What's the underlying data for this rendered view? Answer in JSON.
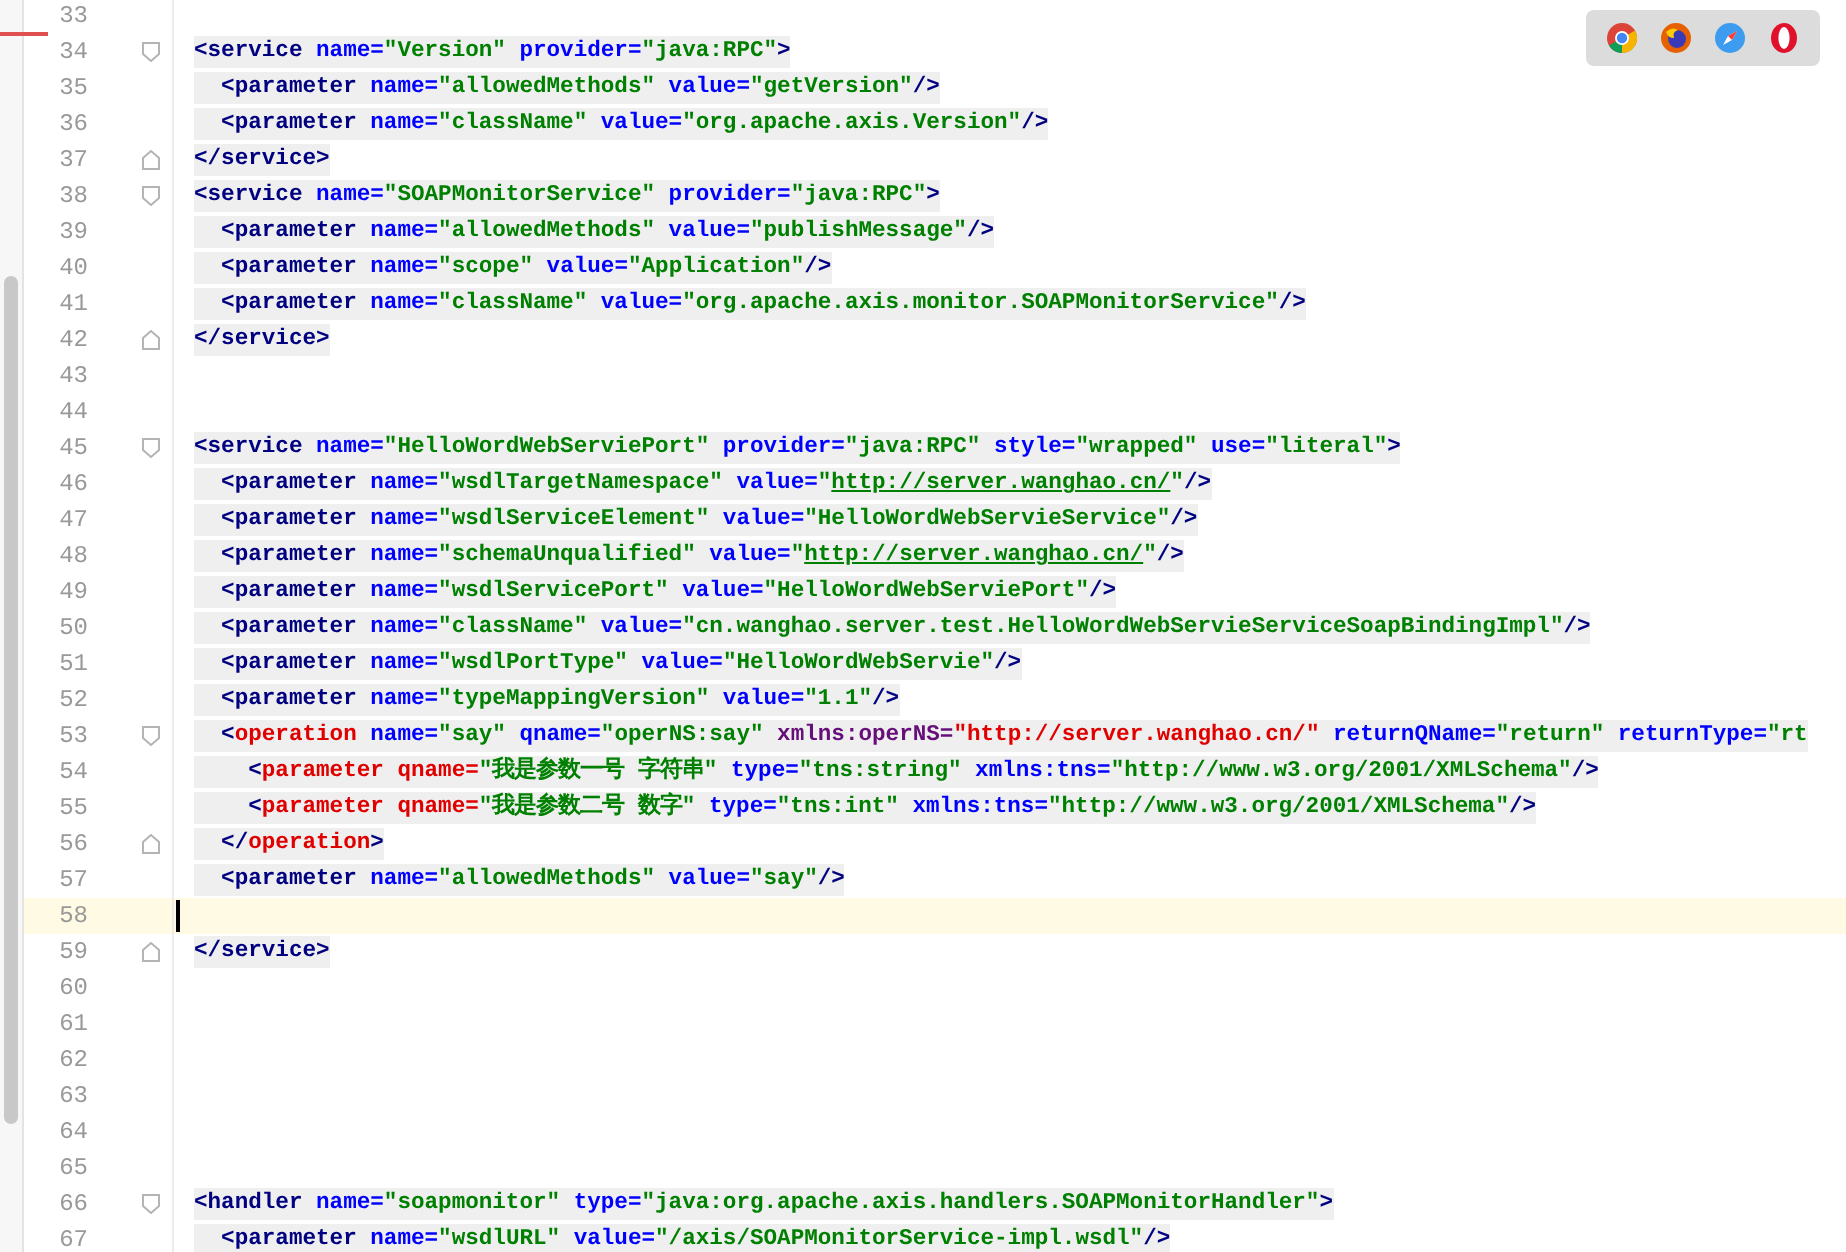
{
  "browsers": [
    {
      "kind": "chrome"
    },
    {
      "kind": "firefox"
    },
    {
      "kind": "safari"
    },
    {
      "kind": "opera"
    }
  ],
  "lines": [
    {
      "number": "33",
      "kind": "plain"
    },
    {
      "number": "34",
      "kind": "fold_start",
      "tokens": [
        {
          "kind": "tag",
          "text": "<service"
        },
        {
          "kind": "attr",
          "text": " name="
        },
        {
          "kind": "val",
          "text": "\"Version\""
        },
        {
          "kind": "attr",
          "text": " provider="
        },
        {
          "kind": "val",
          "text": "\"java:RPC\""
        },
        {
          "kind": "tag",
          "text": ">"
        }
      ]
    },
    {
      "number": "35",
      "kind": "plain",
      "tokens": [
        {
          "kind": "tag",
          "text": "  <parameter"
        },
        {
          "kind": "attr",
          "text": " name="
        },
        {
          "kind": "val",
          "text": "\"allowedMethods\""
        },
        {
          "kind": "attr",
          "text": " value="
        },
        {
          "kind": "val",
          "text": "\"getVersion\""
        },
        {
          "kind": "tag",
          "text": "/>"
        }
      ]
    },
    {
      "number": "36",
      "kind": "plain",
      "tokens": [
        {
          "kind": "tag",
          "text": "  <parameter"
        },
        {
          "kind": "attr",
          "text": " name="
        },
        {
          "kind": "val",
          "text": "\"className\""
        },
        {
          "kind": "attr",
          "text": " value="
        },
        {
          "kind": "val",
          "text": "\"org.apache.axis.Version\""
        },
        {
          "kind": "tag",
          "text": "/>"
        }
      ]
    },
    {
      "number": "37",
      "kind": "fold_end",
      "tokens": [
        {
          "kind": "tag",
          "text": "</service>"
        }
      ]
    },
    {
      "number": "38",
      "kind": "fold_start",
      "tokens": [
        {
          "kind": "tag",
          "text": "<service"
        },
        {
          "kind": "attr",
          "text": " name="
        },
        {
          "kind": "val",
          "text": "\"SOAPMonitorService\""
        },
        {
          "kind": "attr",
          "text": " provider="
        },
        {
          "kind": "val",
          "text": "\"java:RPC\""
        },
        {
          "kind": "tag",
          "text": ">"
        }
      ]
    },
    {
      "number": "39",
      "kind": "plain",
      "tokens": [
        {
          "kind": "tag",
          "text": "  <parameter"
        },
        {
          "kind": "attr",
          "text": " name="
        },
        {
          "kind": "val",
          "text": "\"allowedMethods\""
        },
        {
          "kind": "attr",
          "text": " value="
        },
        {
          "kind": "val",
          "text": "\"publishMessage\""
        },
        {
          "kind": "tag",
          "text": "/>"
        }
      ]
    },
    {
      "number": "40",
      "kind": "plain",
      "tokens": [
        {
          "kind": "tag",
          "text": "  <parameter"
        },
        {
          "kind": "attr",
          "text": " name="
        },
        {
          "kind": "val",
          "text": "\"scope\""
        },
        {
          "kind": "attr",
          "text": " value="
        },
        {
          "kind": "val",
          "text": "\"Application\""
        },
        {
          "kind": "tag",
          "text": "/>"
        }
      ]
    },
    {
      "number": "41",
      "kind": "plain",
      "tokens": [
        {
          "kind": "tag",
          "text": "  <parameter"
        },
        {
          "kind": "attr",
          "text": " name="
        },
        {
          "kind": "val",
          "text": "\"className\""
        },
        {
          "kind": "attr",
          "text": " value="
        },
        {
          "kind": "val",
          "text": "\"org.apache.axis.monitor.SOAPMonitorService\""
        },
        {
          "kind": "tag",
          "text": "/>"
        }
      ]
    },
    {
      "number": "42",
      "kind": "fold_end",
      "tokens": [
        {
          "kind": "tag",
          "text": "</service>"
        }
      ]
    },
    {
      "number": "43",
      "kind": "plain"
    },
    {
      "number": "44",
      "kind": "plain"
    },
    {
      "number": "45",
      "kind": "fold_start",
      "tokens": [
        {
          "kind": "tag",
          "text": "<service"
        },
        {
          "kind": "attr",
          "text": " name="
        },
        {
          "kind": "val",
          "text": "\"HelloWordWebServiePort\""
        },
        {
          "kind": "attr",
          "text": " provider="
        },
        {
          "kind": "val",
          "text": "\"java:RPC\""
        },
        {
          "kind": "attr",
          "text": " style="
        },
        {
          "kind": "val",
          "text": "\"wrapped\""
        },
        {
          "kind": "attr",
          "text": " use="
        },
        {
          "kind": "val",
          "text": "\"literal\""
        },
        {
          "kind": "tag",
          "text": ">"
        }
      ]
    },
    {
      "number": "46",
      "kind": "plain",
      "tokens": [
        {
          "kind": "tag",
          "text": "  <parameter"
        },
        {
          "kind": "attr",
          "text": " name="
        },
        {
          "kind": "val",
          "text": "\"wsdlTargetNamespace\""
        },
        {
          "kind": "attr",
          "text": " value="
        },
        {
          "kind": "val",
          "text": "\""
        },
        {
          "kind": "link",
          "text": "http://server.wanghao.cn/"
        },
        {
          "kind": "val",
          "text": "\""
        },
        {
          "kind": "tag",
          "text": "/>"
        }
      ]
    },
    {
      "number": "47",
      "kind": "plain",
      "tokens": [
        {
          "kind": "tag",
          "text": "  <parameter"
        },
        {
          "kind": "attr",
          "text": " name="
        },
        {
          "kind": "val",
          "text": "\"wsdlServiceElement\""
        },
        {
          "kind": "attr",
          "text": " value="
        },
        {
          "kind": "val",
          "text": "\"HelloWordWebServieService\""
        },
        {
          "kind": "tag",
          "text": "/>"
        }
      ]
    },
    {
      "number": "48",
      "kind": "plain",
      "tokens": [
        {
          "kind": "tag",
          "text": "  <parameter"
        },
        {
          "kind": "attr",
          "text": " name="
        },
        {
          "kind": "val",
          "text": "\"schemaUnqualified\""
        },
        {
          "kind": "attr",
          "text": " value="
        },
        {
          "kind": "val",
          "text": "\""
        },
        {
          "kind": "link",
          "text": "http://server.wanghao.cn/"
        },
        {
          "kind": "val",
          "text": "\""
        },
        {
          "kind": "tag",
          "text": "/>"
        }
      ]
    },
    {
      "number": "49",
      "kind": "plain",
      "tokens": [
        {
          "kind": "tag",
          "text": "  <parameter"
        },
        {
          "kind": "attr",
          "text": " name="
        },
        {
          "kind": "val",
          "text": "\"wsdlServicePort\""
        },
        {
          "kind": "attr",
          "text": " value="
        },
        {
          "kind": "val",
          "text": "\"HelloWordWebServiePort\""
        },
        {
          "kind": "tag",
          "text": "/>"
        }
      ]
    },
    {
      "number": "50",
      "kind": "plain",
      "tokens": [
        {
          "kind": "tag",
          "text": "  <parameter"
        },
        {
          "kind": "attr",
          "text": " name="
        },
        {
          "kind": "val",
          "text": "\"className\""
        },
        {
          "kind": "attr",
          "text": " value="
        },
        {
          "kind": "val",
          "text": "\"cn.wanghao.server.test.HelloWordWebServieServiceSoapBindingImpl\""
        },
        {
          "kind": "tag",
          "text": "/>"
        }
      ]
    },
    {
      "number": "51",
      "kind": "plain",
      "tokens": [
        {
          "kind": "tag",
          "text": "  <parameter"
        },
        {
          "kind": "attr",
          "text": " name="
        },
        {
          "kind": "val",
          "text": "\"wsdlPortType\""
        },
        {
          "kind": "attr",
          "text": " value="
        },
        {
          "kind": "val",
          "text": "\"HelloWordWebServie\""
        },
        {
          "kind": "tag",
          "text": "/>"
        }
      ]
    },
    {
      "number": "52",
      "kind": "plain",
      "tokens": [
        {
          "kind": "tag",
          "text": "  <parameter"
        },
        {
          "kind": "attr",
          "text": " name="
        },
        {
          "kind": "val",
          "text": "\"typeMappingVersion\""
        },
        {
          "kind": "attr",
          "text": " value="
        },
        {
          "kind": "val",
          "text": "\"1.1\""
        },
        {
          "kind": "tag",
          "text": "/>"
        }
      ]
    },
    {
      "number": "53",
      "kind": "fold_start",
      "tokens": [
        {
          "kind": "tag",
          "text": "  <"
        },
        {
          "kind": "optag",
          "text": "operation"
        },
        {
          "kind": "attr",
          "text": " name="
        },
        {
          "kind": "val",
          "text": "\"say\""
        },
        {
          "kind": "attr",
          "text": " qname="
        },
        {
          "kind": "val",
          "text": "\"operNS:say\""
        },
        {
          "kind": "nsattr",
          "text": " xmlns:operNS="
        },
        {
          "kind": "redval",
          "text": "\"http://server.wanghao.cn/\""
        },
        {
          "kind": "attr",
          "text": " returnQName="
        },
        {
          "kind": "val",
          "text": "\"return\""
        },
        {
          "kind": "attr",
          "text": " returnType="
        },
        {
          "kind": "val",
          "text": "\"rt"
        }
      ]
    },
    {
      "number": "54",
      "kind": "plain",
      "tokens": [
        {
          "kind": "tag",
          "text": "    <"
        },
        {
          "kind": "optag",
          "text": "parameter qname="
        },
        {
          "kind": "val",
          "text": "\"我是参数一号 字符串\""
        },
        {
          "kind": "attr",
          "text": " type="
        },
        {
          "kind": "val",
          "text": "\"tns:string\""
        },
        {
          "kind": "attr",
          "text": " xmlns:tns="
        },
        {
          "kind": "val",
          "text": "\"http://www.w3.org/2001/XMLSchema\""
        },
        {
          "kind": "tag",
          "text": "/>"
        }
      ]
    },
    {
      "number": "55",
      "kind": "plain",
      "tokens": [
        {
          "kind": "tag",
          "text": "    <"
        },
        {
          "kind": "optag",
          "text": "parameter qname="
        },
        {
          "kind": "val",
          "text": "\"我是参数二号 数字\""
        },
        {
          "kind": "attr",
          "text": " type="
        },
        {
          "kind": "val",
          "text": "\"tns:int\""
        },
        {
          "kind": "attr",
          "text": " xmlns:tns="
        },
        {
          "kind": "val",
          "text": "\"http://www.w3.org/2001/XMLSchema\""
        },
        {
          "kind": "tag",
          "text": "/>"
        }
      ]
    },
    {
      "number": "56",
      "kind": "fold_end",
      "tokens": [
        {
          "kind": "tag",
          "text": "  </"
        },
        {
          "kind": "optag",
          "text": "operation"
        },
        {
          "kind": "tag",
          "text": ">"
        }
      ]
    },
    {
      "number": "57",
      "kind": "plain",
      "tokens": [
        {
          "kind": "tag",
          "text": "  <parameter"
        },
        {
          "kind": "attr",
          "text": " name="
        },
        {
          "kind": "val",
          "text": "\"allowedMethods\""
        },
        {
          "kind": "attr",
          "text": " value="
        },
        {
          "kind": "val",
          "text": "\"say\""
        },
        {
          "kind": "tag",
          "text": "/>"
        }
      ]
    },
    {
      "number": "58",
      "kind": "plain",
      "current": true
    },
    {
      "number": "59",
      "kind": "fold_end",
      "tokens": [
        {
          "kind": "tag",
          "text": "</service>"
        }
      ]
    },
    {
      "number": "60",
      "kind": "plain"
    },
    {
      "number": "61",
      "kind": "plain"
    },
    {
      "number": "62",
      "kind": "plain"
    },
    {
      "number": "63",
      "kind": "plain"
    },
    {
      "number": "64",
      "kind": "plain"
    },
    {
      "number": "65",
      "kind": "plain"
    },
    {
      "number": "66",
      "kind": "fold_start",
      "tokens": [
        {
          "kind": "tag",
          "text": "<handler"
        },
        {
          "kind": "attr",
          "text": " name="
        },
        {
          "kind": "val",
          "text": "\"soapmonitor\""
        },
        {
          "kind": "attr",
          "text": " type="
        },
        {
          "kind": "val",
          "text": "\"java:org.apache.axis.handlers.SOAPMonitorHandler\""
        },
        {
          "kind": "tag",
          "text": ">"
        }
      ]
    },
    {
      "number": "67",
      "kind": "plain",
      "tokens": [
        {
          "kind": "tag",
          "text": "  <parameter"
        },
        {
          "kind": "attr",
          "text": " name="
        },
        {
          "kind": "val",
          "text": "\"wsdlURL\""
        },
        {
          "kind": "attr",
          "text": " value="
        },
        {
          "kind": "val",
          "text": "\"/axis/SOAPMonitorService-impl.wsdl\""
        },
        {
          "kind": "tag",
          "text": "/>"
        }
      ]
    }
  ]
}
